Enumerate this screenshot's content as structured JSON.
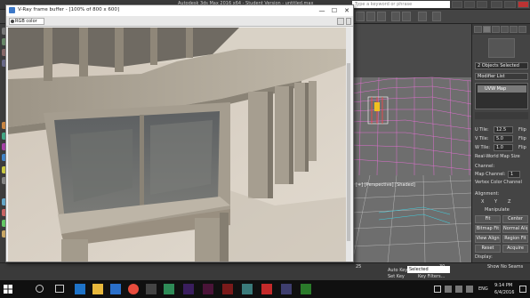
{
  "max": {
    "title": "Autodesk 3ds Max 2016 x64 - Student Version - untitled.max",
    "search_placeholder": "Type a keyword or phrase",
    "viewport": {
      "label": "[+] [Perspective] [Shaded]"
    },
    "command_panel": {
      "selection_label": "2 Objects Selected",
      "modifier_list_label": "Modifier List",
      "stack_item": "UVW Map",
      "u_tile_label": "U Tile:",
      "u_tile_value": "12.5",
      "v_tile_label": "V Tile:",
      "v_tile_value": "5.0",
      "w_tile_label": "W Tile:",
      "w_tile_value": "1.0",
      "flip_label": "Flip",
      "real_world_label": "Real-World Map Size",
      "channel_label": "Channel:",
      "map_channel_label": "Map Channel:",
      "map_channel_value": "1",
      "vertex_color_label": "Vertex Color Channel",
      "alignment_label": "Alignment:",
      "axis_x": "X",
      "axis_y": "Y",
      "axis_z": "Z",
      "manipulate_label": "Manipulate",
      "fit_label": "Fit",
      "center_label": "Center",
      "bitmap_fit_label": "Bitmap Fit",
      "normal_align_label": "Normal Align",
      "view_align_label": "View Align",
      "region_fit_label": "Region Fit",
      "reset_label": "Reset",
      "acquire_label": "Acquire",
      "display_label": "Display:",
      "show_no_seams_label": "Show No Seams"
    },
    "statusbar": {
      "auto_key_label": "Auto Key",
      "selected_value": "Selected",
      "set_key_label": "Set Key",
      "key_filters_label": "Key Filters...",
      "timeline_ticks": [
        "25",
        "30"
      ]
    }
  },
  "vfb": {
    "title": "V-Ray frame buffer - [100% of 800 x 600]",
    "channel": "RGB color",
    "win_controls": {
      "minimize": "—",
      "maximize": "☐",
      "close": "✕"
    }
  },
  "taskbar": {
    "language": "ENG",
    "time": "9:14 PM",
    "date": "6/4/2016"
  },
  "colors": {
    "max_bg": "#444444",
    "wire_pink": "#e070d0",
    "wire_white": "#ffffff",
    "taskbar_bg": "#101010",
    "concrete": "#b8ae9f",
    "ground": "#d4cbbf"
  }
}
